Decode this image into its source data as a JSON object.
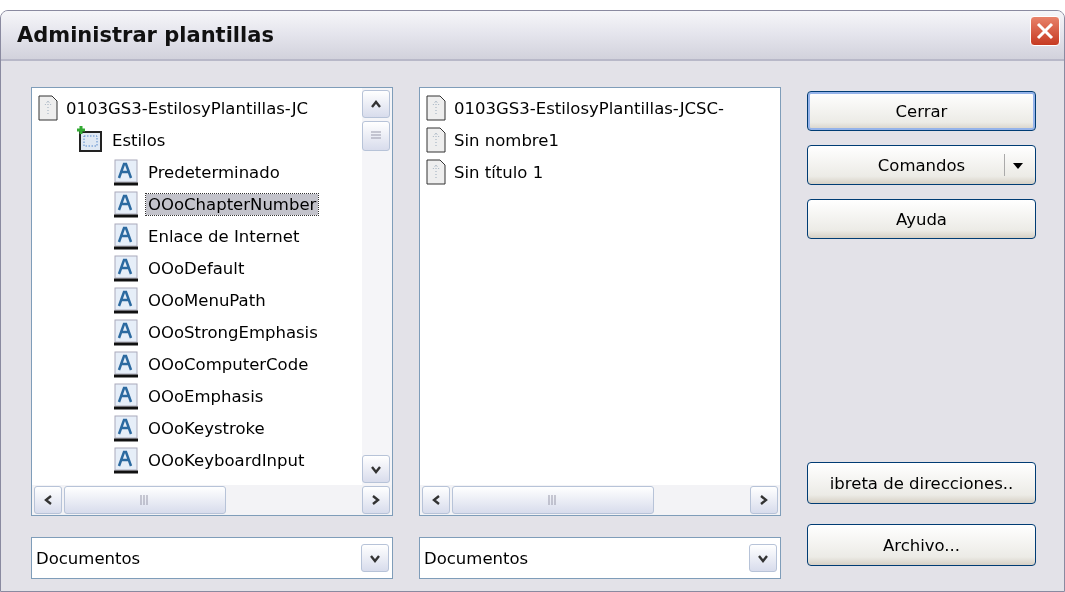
{
  "window": {
    "title": "Administrar plantillas"
  },
  "left_list": {
    "items": [
      {
        "label": "0103GS3-EstilosyPlantillas-JC",
        "kind": "document",
        "children": [
          {
            "label": "Estilos",
            "kind": "folder",
            "children": [
              {
                "label": "Predeterminado",
                "kind": "style",
                "selected": false
              },
              {
                "label": "OOoChapterNumber",
                "kind": "style",
                "selected": true
              },
              {
                "label": "Enlace de Internet",
                "kind": "style",
                "selected": false
              },
              {
                "label": "OOoDefault",
                "kind": "style",
                "selected": false
              },
              {
                "label": "OOoMenuPath",
                "kind": "style",
                "selected": false
              },
              {
                "label": "OOoStrongEmphasis",
                "kind": "style",
                "selected": false
              },
              {
                "label": "OOoComputerCode",
                "kind": "style",
                "selected": false
              },
              {
                "label": "OOoEmphasis",
                "kind": "style",
                "selected": false
              },
              {
                "label": "OOoKeystroke",
                "kind": "style",
                "selected": false
              },
              {
                "label": "OOoKeyboardInput",
                "kind": "style",
                "selected": false
              }
            ]
          }
        ]
      }
    ],
    "dropdown": "Documentos"
  },
  "right_list": {
    "items": [
      {
        "label": "0103GS3-EstilosyPlantillas-JCSC-",
        "kind": "document"
      },
      {
        "label": "Sin nombre1",
        "kind": "document"
      },
      {
        "label": "Sin título 1",
        "kind": "document"
      }
    ],
    "dropdown": "Documentos"
  },
  "buttons_top": [
    {
      "label": "Cerrar",
      "kind": "default"
    },
    {
      "label": "Comandos",
      "kind": "split"
    },
    {
      "label": "Ayuda",
      "kind": "plain"
    }
  ],
  "buttons_bottom": [
    {
      "label": "ibreta de direcciones..",
      "kind": "plain"
    },
    {
      "label": "Archivo...",
      "kind": "plain"
    }
  ]
}
